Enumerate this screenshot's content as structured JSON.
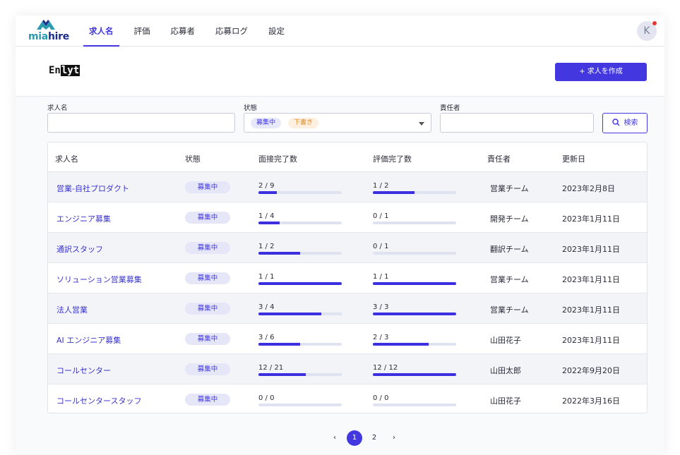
{
  "app": {
    "logo": "miahire",
    "logo_prefix": "mia",
    "logo_suffix": "hire",
    "avatar_initial": "K"
  },
  "nav": [
    {
      "label": "求人名",
      "active": true
    },
    {
      "label": "評価",
      "active": false
    },
    {
      "label": "応募者",
      "active": false
    },
    {
      "label": "応募ログ",
      "active": false
    },
    {
      "label": "設定",
      "active": false
    }
  ],
  "company": {
    "logo_prefix": "En",
    "logo_suffix": "lyt",
    "create_label": "+ 求人を作成"
  },
  "filters": {
    "job_label": "求人名",
    "job_value": "",
    "status_label": "状態",
    "status_chips": [
      "募集中",
      "下書き"
    ],
    "owner_label": "責任者",
    "owner_value": "",
    "search_label": "検索"
  },
  "table": {
    "headers": [
      "求人名",
      "状態",
      "面接完了数",
      "評価完了数",
      "責任者",
      "更新日"
    ],
    "rows": [
      {
        "job": "営業-自社プロダクト",
        "status": "募集中",
        "interview": "2 / 9",
        "interview_ratio": 0.222,
        "evaluation": "1 / 2",
        "evaluation_ratio": 0.5,
        "owner": "営業チーム",
        "updated": "2023年2月8日"
      },
      {
        "job": "エンジニア募集",
        "status": "募集中",
        "interview": "1 / 4",
        "interview_ratio": 0.25,
        "evaluation": "0 / 1",
        "evaluation_ratio": 0,
        "owner": "開発チーム",
        "updated": "2023年1月11日"
      },
      {
        "job": "通訳スタッフ",
        "status": "募集中",
        "interview": "1 / 2",
        "interview_ratio": 0.5,
        "evaluation": "0 / 1",
        "evaluation_ratio": 0,
        "owner": "翻訳チーム",
        "updated": "2023年1月11日"
      },
      {
        "job": "ソリューション営業募集",
        "status": "募集中",
        "interview": "1 / 1",
        "interview_ratio": 1,
        "evaluation": "1 / 1",
        "evaluation_ratio": 1,
        "owner": "営業チーム",
        "updated": "2023年1月11日"
      },
      {
        "job": "法人営業",
        "status": "募集中",
        "interview": "3 / 4",
        "interview_ratio": 0.75,
        "evaluation": "3 / 3",
        "evaluation_ratio": 1,
        "owner": "営業チーム",
        "updated": "2023年1月11日"
      },
      {
        "job": "AI エンジニア募集",
        "status": "募集中",
        "interview": "3 / 6",
        "interview_ratio": 0.5,
        "evaluation": "2 / 3",
        "evaluation_ratio": 0.667,
        "owner": "山田花子",
        "updated": "2023年1月11日"
      },
      {
        "job": "コールセンター",
        "status": "募集中",
        "interview": "12 / 21",
        "interview_ratio": 0.571,
        "evaluation": "12 / 12",
        "evaluation_ratio": 1,
        "owner": "山田太郎",
        "updated": "2022年9月20日"
      },
      {
        "job": "コールセンタースタッフ",
        "status": "募集中",
        "interview": "0 / 0",
        "interview_ratio": 0,
        "evaluation": "0 / 0",
        "evaluation_ratio": 0,
        "owner": "山田花子",
        "updated": "2022年3月16日"
      }
    ]
  },
  "pagination": {
    "prev": "‹",
    "pages": [
      "1",
      "2"
    ],
    "current": "1",
    "next": "›"
  },
  "colors": {
    "accent": "#4338e0",
    "bar_track": "#dfe3ef",
    "badge_bg": "#e5e6f7",
    "draft": "#e08a1e"
  },
  "icons": [
    "search-icon",
    "chevron-down-icon",
    "chevron-left-icon",
    "chevron-right-icon"
  ]
}
